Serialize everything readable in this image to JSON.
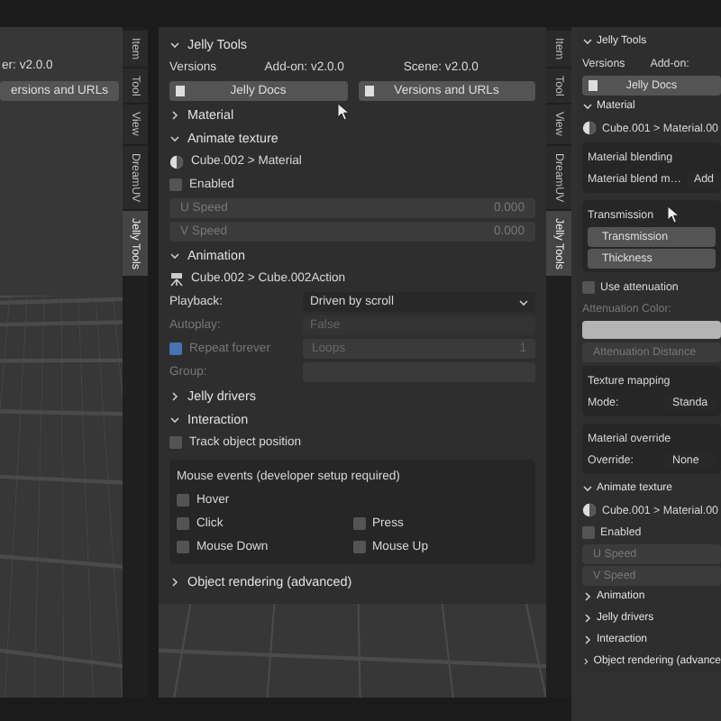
{
  "left": {
    "version_text": "er: v2.0.0",
    "button": "ersions and URLs",
    "tabs": [
      {
        "label": "Item",
        "selected": false
      },
      {
        "label": "Tool",
        "selected": false
      },
      {
        "label": "View",
        "selected": false
      },
      {
        "label": "DreamUV",
        "selected": false
      },
      {
        "label": "Jelly Tools",
        "selected": true
      }
    ]
  },
  "middle": {
    "rows": [
      {
        "kind": "header",
        "label": "Jelly Tools",
        "expanded": true
      },
      {
        "kind": "versions",
        "cells": [
          "Versions",
          "Add-on: v2.0.0",
          "Scene: v2.0.0"
        ]
      },
      {
        "kind": "buttons",
        "items": [
          "Jelly Docs",
          "Versions and URLs"
        ]
      },
      {
        "kind": "header",
        "label": "Material",
        "expanded": false
      },
      {
        "kind": "header",
        "label": "Animate texture",
        "expanded": true
      },
      {
        "kind": "material_path",
        "label": "Cube.002 > Material"
      },
      {
        "kind": "checkbox",
        "label": "Enabled",
        "checked": false
      },
      {
        "kind": "slider",
        "label": "U Speed",
        "value": "0.000",
        "disabled": true
      },
      {
        "kind": "slider",
        "label": "V Speed",
        "value": "0.000",
        "disabled": true
      },
      {
        "kind": "header",
        "label": "Animation",
        "expanded": true
      },
      {
        "kind": "action_path",
        "label": "Cube.002 > Cube.002Action"
      },
      {
        "kind": "dropdown",
        "label": "Playback:",
        "value": "Driven by scroll",
        "disabled": false
      },
      {
        "kind": "dropdown",
        "label": "Autoplay:",
        "value": "False",
        "disabled": true
      },
      {
        "kind": "checkfield",
        "label": "Repeat forever",
        "checked": true,
        "field_label": "Loops",
        "field_value": "1",
        "disabled": true
      },
      {
        "kind": "field",
        "label": "Group:",
        "disabled": true
      },
      {
        "kind": "header",
        "label": "Jelly drivers",
        "expanded": false
      },
      {
        "kind": "header",
        "label": "Interaction",
        "expanded": true
      },
      {
        "kind": "checkbox",
        "label": "Track object position",
        "checked": false
      },
      {
        "kind": "box",
        "title": "Mouse events (developer setup required)",
        "rows": [
          {
            "kind": "checkrow",
            "items": [
              {
                "label": "Hover",
                "checked": false
              }
            ]
          },
          {
            "kind": "checkrow",
            "items": [
              {
                "label": "Click",
                "checked": false
              },
              {
                "label": "Press",
                "checked": false
              }
            ]
          },
          {
            "kind": "checkrow",
            "items": [
              {
                "label": "Mouse Down",
                "checked": false
              },
              {
                "label": "Mouse Up",
                "checked": false
              }
            ]
          }
        ]
      },
      {
        "kind": "header",
        "label": "Object rendering (advanced)",
        "expanded": false
      }
    ]
  },
  "tabs": [
    {
      "label": "Item",
      "selected": false
    },
    {
      "label": "Tool",
      "selected": false
    },
    {
      "label": "View",
      "selected": false
    },
    {
      "label": "DreamUV",
      "selected": false
    },
    {
      "label": "Jelly Tools",
      "selected": true
    }
  ],
  "right": {
    "rows": [
      {
        "kind": "header",
        "label": "Jelly Tools",
        "expanded": true
      },
      {
        "kind": "versions",
        "cells": [
          "Versions",
          "Add-on:"
        ]
      },
      {
        "kind": "buttons",
        "items": [
          "Jelly Docs"
        ]
      },
      {
        "kind": "header",
        "label": "Material",
        "expanded": true
      },
      {
        "kind": "material_path",
        "label": "Cube.001 > Material.00"
      },
      {
        "kind": "box",
        "title": "Material blending",
        "rows": [
          {
            "kind": "pair",
            "label": "Material blend m…",
            "value": "Add"
          }
        ]
      },
      {
        "kind": "box",
        "title": "Transmission",
        "rows": [
          {
            "kind": "button",
            "label": "Transmission"
          },
          {
            "kind": "button",
            "label": "Thickness"
          }
        ]
      },
      {
        "kind": "checkbox",
        "label": "Use attenuation",
        "checked": false
      },
      {
        "kind": "label",
        "label": "Attenuation Color:"
      },
      {
        "kind": "color_field"
      },
      {
        "kind": "slider",
        "label": "Attenuation Distance",
        "disabled": true
      },
      {
        "kind": "box",
        "title": "Texture mapping",
        "rows": [
          {
            "kind": "pair",
            "label": "Mode:",
            "value": "Standa"
          }
        ]
      },
      {
        "kind": "box",
        "title": "Material override",
        "rows": [
          {
            "kind": "pair",
            "label": "Override:",
            "value": "None"
          }
        ]
      },
      {
        "kind": "header",
        "label": "Animate texture",
        "expanded": true
      },
      {
        "kind": "material_path",
        "label": "Cube.001 > Material.00"
      },
      {
        "kind": "checkbox",
        "label": "Enabled",
        "checked": false
      },
      {
        "kind": "slider",
        "label": "U Speed",
        "disabled": true
      },
      {
        "kind": "slider",
        "label": "V Speed",
        "disabled": true
      },
      {
        "kind": "header",
        "label": "Animation",
        "expanded": false
      },
      {
        "kind": "header",
        "label": "Jelly drivers",
        "expanded": false
      },
      {
        "kind": "header",
        "label": "Interaction",
        "expanded": false
      },
      {
        "kind": "header",
        "label": "Object rendering (advance",
        "expanded": false
      }
    ]
  }
}
